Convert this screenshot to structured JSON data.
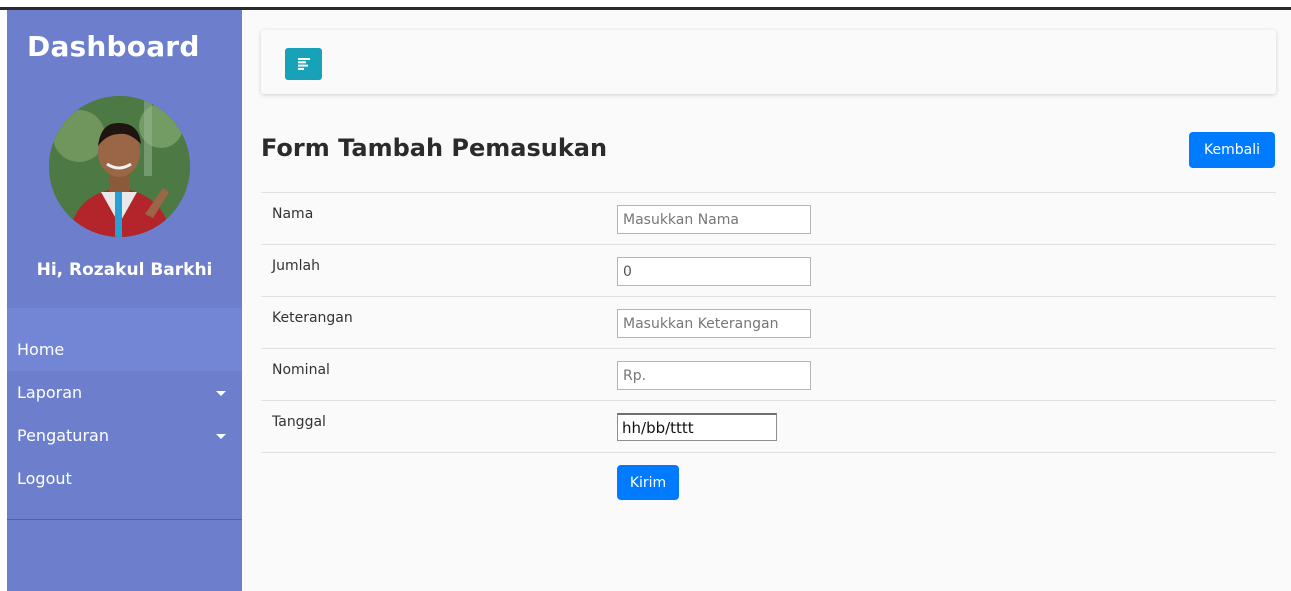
{
  "sidebar": {
    "title": "Dashboard",
    "greeting": "Hi, Rozakul Barkhi",
    "menu": [
      {
        "label": "Home"
      },
      {
        "label": "Laporan"
      },
      {
        "label": "Pengaturan"
      },
      {
        "label": "Logout"
      }
    ]
  },
  "main": {
    "title": "Form Tambah Pemasukan",
    "back_label": "Kembali",
    "submit_label": "Kirim",
    "fields": [
      {
        "label": "Nama",
        "placeholder": "Masukkan Nama",
        "value": ""
      },
      {
        "label": "Jumlah",
        "placeholder": "",
        "value": "0"
      },
      {
        "label": "Keterangan",
        "placeholder": "Masukkan Keterangan",
        "value": ""
      },
      {
        "label": "Nominal",
        "placeholder": "Rp.",
        "value": ""
      },
      {
        "label": "Tanggal",
        "placeholder": "",
        "value": "hh/bb/tttt"
      }
    ]
  },
  "colors": {
    "sidebar": "#6d7fcc",
    "primary": "#007bff",
    "toggle": "#17a2b8"
  },
  "icons": {
    "toggle": "align-left-icon",
    "dropdown": "caret-down-icon"
  }
}
